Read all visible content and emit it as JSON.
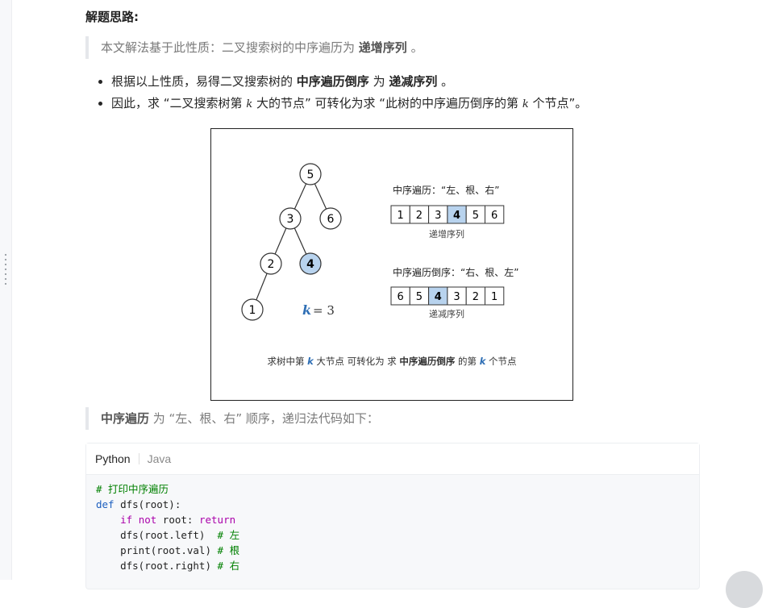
{
  "heading": "解题思路:",
  "quote1": {
    "prefix": "本文解法基于此性质：二叉搜索树的中序遍历为 ",
    "emph": "递增序列",
    "suffix": " 。"
  },
  "bullets": [
    {
      "a": "根据以上性质，易得二叉搜索树的 ",
      "b": "中序遍历倒序",
      "c": " 为 ",
      "d": "递减序列",
      "e": " 。"
    },
    {
      "a": "因此，求 “二叉搜索树第 ",
      "k": "k",
      "b": " 大的节点” 可转化为求 “此树的中序遍历倒序的第 ",
      "k2": "k",
      "c": " 个节点”。"
    }
  ],
  "figure": {
    "tree_nodes": [
      "5",
      "3",
      "6",
      "2",
      "4",
      "1"
    ],
    "k_label": "k",
    "k_eq": "= 3",
    "inorder_title": "中序遍历：“左、根、右”",
    "inorder_cells": [
      "1",
      "2",
      "3",
      "4",
      "5",
      "6"
    ],
    "inorder_caption": "递增序列",
    "reverse_title": "中序遍历倒序：“右、根、左”",
    "reverse_cells": [
      "6",
      "5",
      "4",
      "3",
      "2",
      "1"
    ],
    "reverse_caption": "递减序列",
    "caption_parts": [
      "求树中第 ",
      "k",
      " 大节点 可转化为 求 ",
      "中序遍历倒序",
      " 的第 ",
      "k",
      " 个节点"
    ],
    "highlight_color": "#b8d3ee",
    "accent_color": "#2f6fb5"
  },
  "quote2": {
    "emph": "中序遍历",
    "suffix": " 为 “左、根、右” 顺序，递归法代码如下："
  },
  "code": {
    "tabs": [
      "Python",
      "Java"
    ],
    "active_tab": "Python",
    "lines": [
      "# 打印中序遍历",
      "def dfs(root):",
      "    if not root: return",
      "    dfs(root.left)  # 左",
      "    print(root.val) # 根",
      "    dfs(root.right) # 右"
    ]
  }
}
